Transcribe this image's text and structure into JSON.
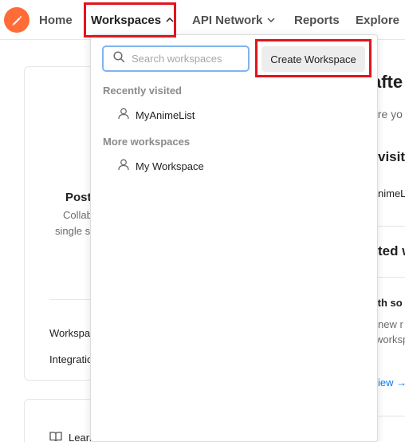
{
  "nav": {
    "home": "Home",
    "workspaces": "Workspaces",
    "api_network": "API Network",
    "reports": "Reports",
    "explore": "Explore"
  },
  "background": {
    "heading_fragment": "afte",
    "sub_fragment": "ere yo",
    "recent_fragment": "visit",
    "anime_fragment": "nimeL",
    "suggested_fragment": "ted w",
    "with_fragment": "ith so",
    "new_fragment": "new r",
    "works_fragment": "worksp",
    "view_link": "iew →",
    "post_title": "Post",
    "collab_text": "Collab",
    "single_text": "single s",
    "workspaces_link": "Workspa",
    "integrations_link": "Integratio",
    "learn_text": "Learn"
  },
  "dropdown": {
    "search_placeholder": "Search workspaces",
    "search_value": "",
    "create_label": "Create Workspace",
    "recent_title": "Recently visited",
    "recent_items": [
      {
        "label": "MyAnimeList",
        "icon": "user-icon"
      }
    ],
    "more_title": "More workspaces",
    "more_items": [
      {
        "label": "My Workspace",
        "icon": "user-icon"
      }
    ]
  },
  "colors": {
    "brand": "#ff6c37",
    "highlight": "#e3141c",
    "search_focus": "#7fb5f0",
    "link": "#097bed"
  }
}
